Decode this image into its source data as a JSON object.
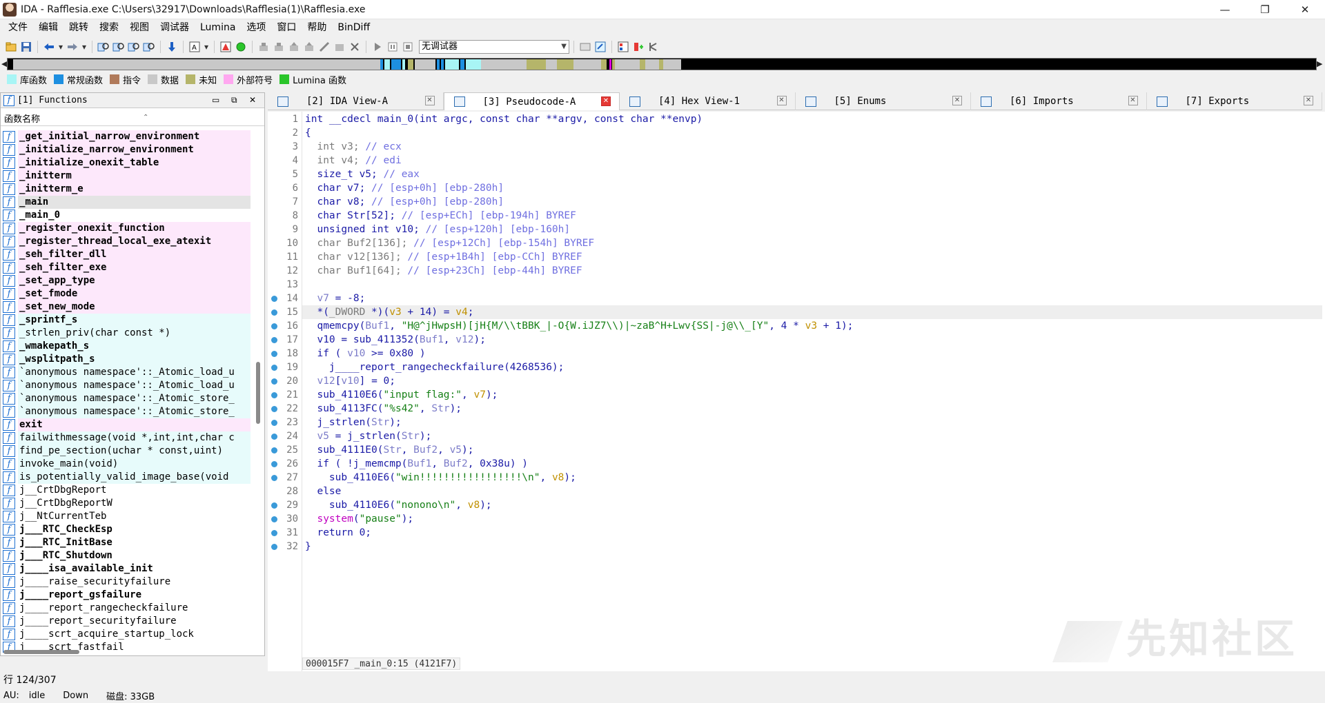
{
  "window": {
    "title": "IDA - Rafflesia.exe C:\\Users\\32917\\Downloads\\Rafflesia(1)\\Rafflesia.exe",
    "min": "—",
    "max": "❐",
    "close": "✕"
  },
  "menu": [
    "文件",
    "编辑",
    "跳转",
    "搜索",
    "视图",
    "调试器",
    "Lumina",
    "选项",
    "窗口",
    "帮助",
    "BinDiff"
  ],
  "toolbar": {
    "debugger_select": "无调试器"
  },
  "legend": [
    {
      "label": "库函数",
      "color": "#a8f5f5"
    },
    {
      "label": "常规函数",
      "color": "#1d8fe0"
    },
    {
      "label": "指令",
      "color": "#b07a5a"
    },
    {
      "label": "数据",
      "color": "#c8c8c8"
    },
    {
      "label": "未知",
      "color": "#b5b56a"
    },
    {
      "label": "外部符号",
      "color": "#ffa8f0"
    },
    {
      "label": "Lumina 函数",
      "color": "#2ac52a"
    }
  ],
  "functions_panel": {
    "title": "[1]  Functions",
    "column_header": "函数名称",
    "items": [
      {
        "name": "_get_initial_narrow_environment",
        "style": "pink bold"
      },
      {
        "name": "_initialize_narrow_environment",
        "style": "pink bold"
      },
      {
        "name": "_initialize_onexit_table",
        "style": "pink bold"
      },
      {
        "name": "_initterm",
        "style": "pink bold"
      },
      {
        "name": "_initterm_e",
        "style": "pink bold"
      },
      {
        "name": "_main",
        "style": "sel bold"
      },
      {
        "name": "_main_0",
        "style": "bold"
      },
      {
        "name": "_register_onexit_function",
        "style": "pink bold"
      },
      {
        "name": "_register_thread_local_exe_atexit",
        "style": "pink bold"
      },
      {
        "name": "_seh_filter_dll",
        "style": "pink bold"
      },
      {
        "name": "_seh_filter_exe",
        "style": "pink bold"
      },
      {
        "name": "_set_app_type",
        "style": "pink bold"
      },
      {
        "name": "_set_fmode",
        "style": "pink bold"
      },
      {
        "name": "_set_new_mode",
        "style": "pink bold"
      },
      {
        "name": "_sprintf_s",
        "style": "cyan bold"
      },
      {
        "name": "_strlen_priv(char const *)",
        "style": "cyan"
      },
      {
        "name": "_wmakepath_s",
        "style": "cyan bold"
      },
      {
        "name": "_wsplitpath_s",
        "style": "cyan bold"
      },
      {
        "name": "`anonymous namespace'::_Atomic_load_u",
        "style": "cyan"
      },
      {
        "name": "`anonymous namespace'::_Atomic_load_u",
        "style": "cyan"
      },
      {
        "name": "`anonymous namespace'::_Atomic_store_",
        "style": "cyan"
      },
      {
        "name": "`anonymous namespace'::_Atomic_store_",
        "style": "cyan"
      },
      {
        "name": "exit",
        "style": "pink bold"
      },
      {
        "name": "failwithmessage(void *,int,int,char c",
        "style": "cyan"
      },
      {
        "name": "find_pe_section(uchar * const,uint)",
        "style": "cyan"
      },
      {
        "name": "invoke_main(void)",
        "style": "cyan"
      },
      {
        "name": "is_potentially_valid_image_base(void",
        "style": "cyan"
      },
      {
        "name": "j__CrtDbgReport",
        "style": ""
      },
      {
        "name": "j__CrtDbgReportW",
        "style": ""
      },
      {
        "name": "j__NtCurrentTeb",
        "style": ""
      },
      {
        "name": "j___RTC_CheckEsp",
        "style": "bold"
      },
      {
        "name": "j___RTC_InitBase",
        "style": "bold"
      },
      {
        "name": "j___RTC_Shutdown",
        "style": "bold"
      },
      {
        "name": "j____isa_available_init",
        "style": "bold"
      },
      {
        "name": "j____raise_securityfailure",
        "style": ""
      },
      {
        "name": "j____report_gsfailure",
        "style": "bold"
      },
      {
        "name": "j____report_rangecheckfailure",
        "style": ""
      },
      {
        "name": "j____report_securityfailure",
        "style": ""
      },
      {
        "name": "j____scrt_acquire_startup_lock",
        "style": ""
      },
      {
        "name": "j____scrt_fastfail",
        "style": ""
      }
    ]
  },
  "row_status": "行 124/307",
  "status_bar": {
    "au": "AU:",
    "state": "idle",
    "dir": "Down",
    "disk": "磁盘: 33GB"
  },
  "tabs": [
    {
      "label": "[2]  IDA View-A",
      "active": false
    },
    {
      "label": "[3]  Pseudocode-A",
      "active": true
    },
    {
      "label": "[4]  Hex View-1",
      "active": false
    },
    {
      "label": "[5]  Enums",
      "active": false
    },
    {
      "label": "[6]  Imports",
      "active": false
    },
    {
      "label": "[7]  Exports",
      "active": false
    }
  ],
  "editor": {
    "highlight_line": 15,
    "breakpoint_lines": [
      14,
      15,
      16,
      17,
      18,
      19,
      20,
      21,
      22,
      23,
      24,
      25,
      26,
      27,
      29,
      30,
      31,
      32
    ],
    "status": "000015F7 _main_0:15 (4121F7)"
  },
  "watermark": "先知社区"
}
